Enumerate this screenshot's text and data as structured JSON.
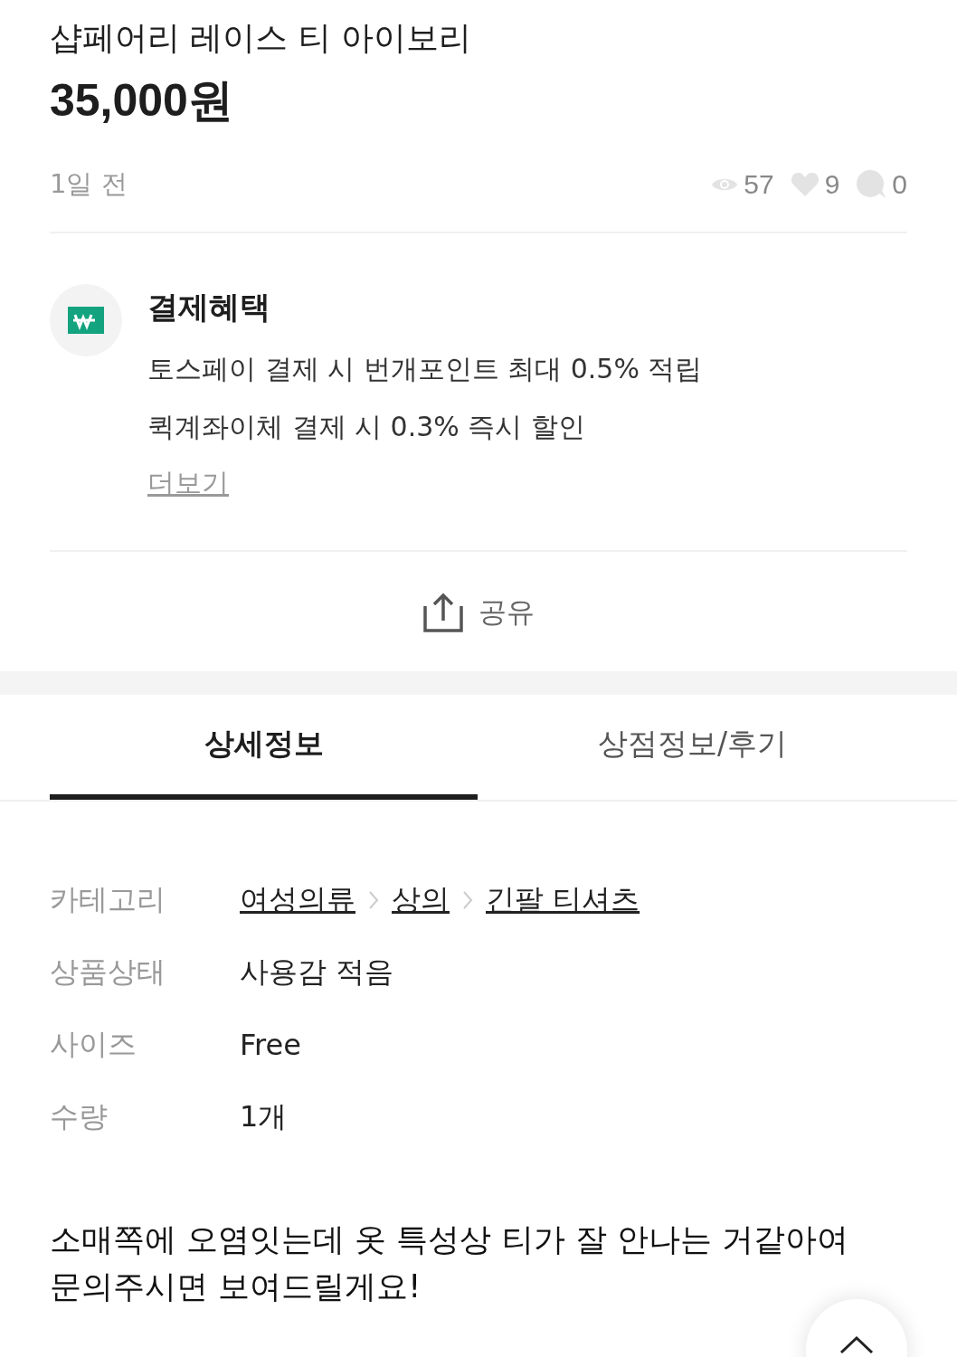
{
  "product": {
    "title": "샵페어리 레이스 티 아이보리",
    "price": "35,000원",
    "time": "1일 전",
    "stats": {
      "views": "57",
      "likes": "9",
      "chats": "0"
    }
  },
  "benefits": {
    "title": "결제혜택",
    "lines": [
      "토스페이 결제 시 번개포인트 최대 0.5% 적립",
      "퀵계좌이체 결제 시 0.3% 즉시 할인"
    ],
    "more": "더보기"
  },
  "share": {
    "label": "공유"
  },
  "tabs": [
    {
      "label": "상세정보",
      "selected": true
    },
    {
      "label": "상점정보/후기",
      "selected": false
    }
  ],
  "specs": [
    {
      "kind": "links",
      "label": "카테고리",
      "links": [
        "여성의류",
        "상의",
        "긴팔 티셔츠"
      ]
    },
    {
      "kind": "text",
      "label": "상품상태",
      "value": "사용감 적음"
    },
    {
      "kind": "text",
      "label": "사이즈",
      "value": "Free"
    },
    {
      "kind": "text",
      "label": "수량",
      "value": "1개"
    }
  ],
  "description": [
    "소매쪽에 오염잇는데 옷 특성상 티가 잘 안나는 거같아여",
    "문의주시면 보여드릴게요!"
  ]
}
